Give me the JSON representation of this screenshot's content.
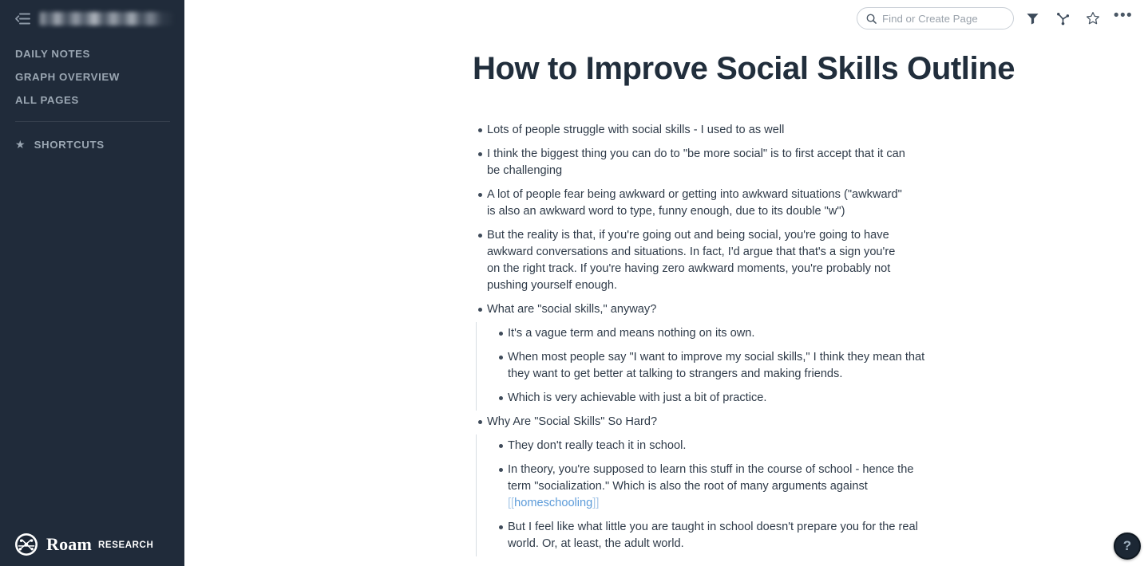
{
  "sidebar": {
    "collapse_icon": "collapse-sidebar-icon",
    "graph_name": "",
    "graph_name_redacted": true,
    "nav": [
      {
        "label": "DAILY NOTES",
        "name": "daily-notes"
      },
      {
        "label": "GRAPH OVERVIEW",
        "name": "graph-overview"
      },
      {
        "label": "ALL PAGES",
        "name": "all-pages"
      }
    ],
    "shortcuts": {
      "label": "SHORTCUTS",
      "icon": "star-icon"
    },
    "logo": {
      "word": "Roam",
      "sub": "RESEARCH",
      "icon": "roam-logo-icon"
    },
    "bg_color": "#202B3A",
    "text_color": "#9AA6B2"
  },
  "topbar": {
    "search": {
      "placeholder": "Find or Create Page",
      "value": "",
      "icon": "search-icon"
    },
    "filter_icon": "filter-icon",
    "graph_icon": "graph-branch-icon",
    "star_icon": "star-outline-icon",
    "more_icon": "more-horizontal-icon",
    "more_glyph": "•••"
  },
  "page": {
    "title": "How to Improve Social Skills Outline",
    "link_color": "#5C9BD9",
    "blocks": [
      {
        "text": "Lots of people struggle with social skills - I used to as well",
        "children": []
      },
      {
        "text": "I think the biggest thing you can do to \"be more social\" is to first accept that it can be challenging",
        "children": []
      },
      {
        "text": "A lot of people fear being awkward or getting into awkward situations (\"awkward\" is also an awkward word to type, funny enough, due to its double \"w\")",
        "children": []
      },
      {
        "text": "But the reality is that, if you're going out and being social, you're going to have awkward conversations and situations. In fact, I'd argue that that's a sign you're on the right track. If you're having zero awkward moments, you're probably not pushing yourself enough.",
        "children": []
      },
      {
        "text": "What are \"social skills,\" anyway?",
        "children": [
          {
            "text": "It's a vague term and means nothing on its own."
          },
          {
            "text": "When most people say \"I want to improve my social skills,\" I think they mean that they want to get better at talking to strangers and making friends."
          },
          {
            "text": "Which is very achievable with just a bit of practice."
          }
        ]
      },
      {
        "text": "Why Are \"Social Skills\" So Hard?",
        "children": [
          {
            "text": "They don't really teach it in school."
          },
          {
            "text_before": "In theory, you're supposed to learn this stuff in the course of school - hence the term \"socialization.\" Which is also the root of many arguments against ",
            "page_ref": "homeschooling",
            "text_after": ""
          },
          {
            "text": "But I feel like what little you are taught in school doesn't prepare you for the real world. Or, at least, the adult world."
          }
        ]
      }
    ]
  },
  "help": {
    "label": "?",
    "icon": "help-icon"
  }
}
